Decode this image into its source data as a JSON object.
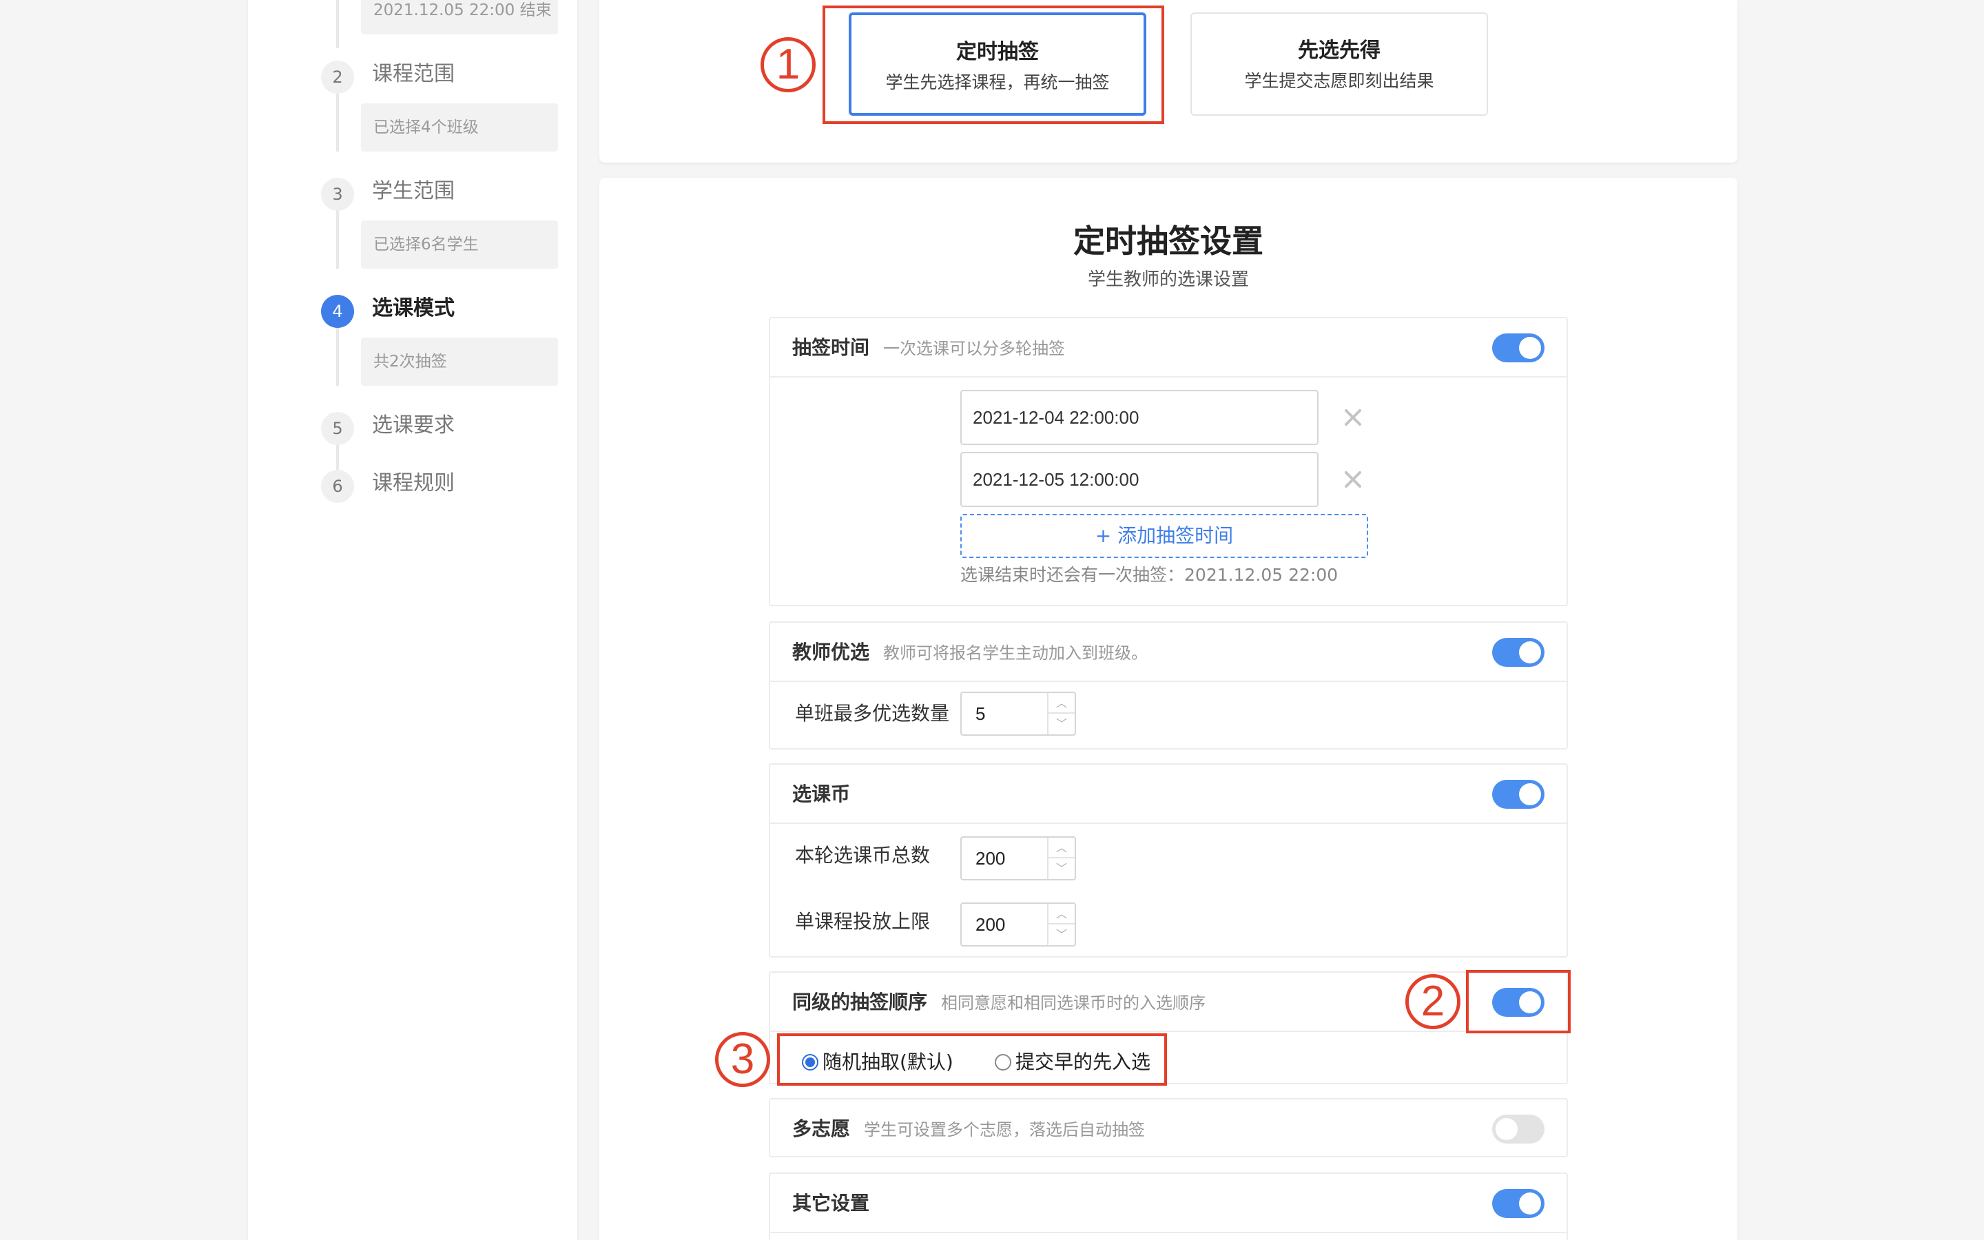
{
  "steps": [
    {
      "number": "",
      "title": "",
      "desc": "2021.12.05 22:00 结束"
    },
    {
      "number": "2",
      "title": "课程范围",
      "desc": "已选择4个班级"
    },
    {
      "number": "3",
      "title": "学生范围",
      "desc": "已选择6名学生"
    },
    {
      "number": "4",
      "title": "选课模式",
      "desc": "共2次抽签",
      "active": true
    },
    {
      "number": "5",
      "title": "选课要求"
    },
    {
      "number": "6",
      "title": "课程规则"
    }
  ],
  "modes": [
    {
      "title": "定时抽签",
      "subtitle": "学生先选择课程，再统一抽签",
      "selected": true
    },
    {
      "title": "先选先得",
      "subtitle": "学生提交志愿即刻出结果",
      "selected": false
    }
  ],
  "settings": {
    "title": "定时抽签设置",
    "subtitle": "学生教师的选课设置",
    "draw_time": {
      "title": "抽签时间",
      "hint": "一次选课可以分多轮抽签",
      "enabled": true,
      "times": [
        "2021-12-04 22:00:00",
        "2021-12-05 12:00:00"
      ],
      "add_label": "添加抽签时间",
      "end_note": "选课结束时还会有一次抽签：2021.12.05 22:00"
    },
    "teacher_pick": {
      "title": "教师优选",
      "hint": "教师可将报名学生主动加入到班级。",
      "enabled": true,
      "max_label": "单班最多优选数量",
      "max_value": "5"
    },
    "coins": {
      "title": "选课币",
      "enabled": true,
      "total_label": "本轮选课币总数",
      "total_value": "200",
      "cap_label": "单课程投放上限",
      "cap_value": "200"
    },
    "order": {
      "title": "同级的抽签顺序",
      "hint": "相同意愿和相同选课币时的入选顺序",
      "enabled": true,
      "options": [
        {
          "label": "随机抽取(默认)",
          "checked": true
        },
        {
          "label": "提交早的先入选",
          "checked": false
        }
      ]
    },
    "multi_wish": {
      "title": "多志愿",
      "hint": "学生可设置多个志愿，落选后自动抽签",
      "enabled": false
    },
    "other": {
      "title": "其它设置",
      "enabled": true
    }
  },
  "annotations": [
    "1",
    "2",
    "3"
  ],
  "colors": {
    "accent": "#3f7ee8",
    "toggle_on": "#4a8ef0",
    "annotation": "#e2402a"
  }
}
